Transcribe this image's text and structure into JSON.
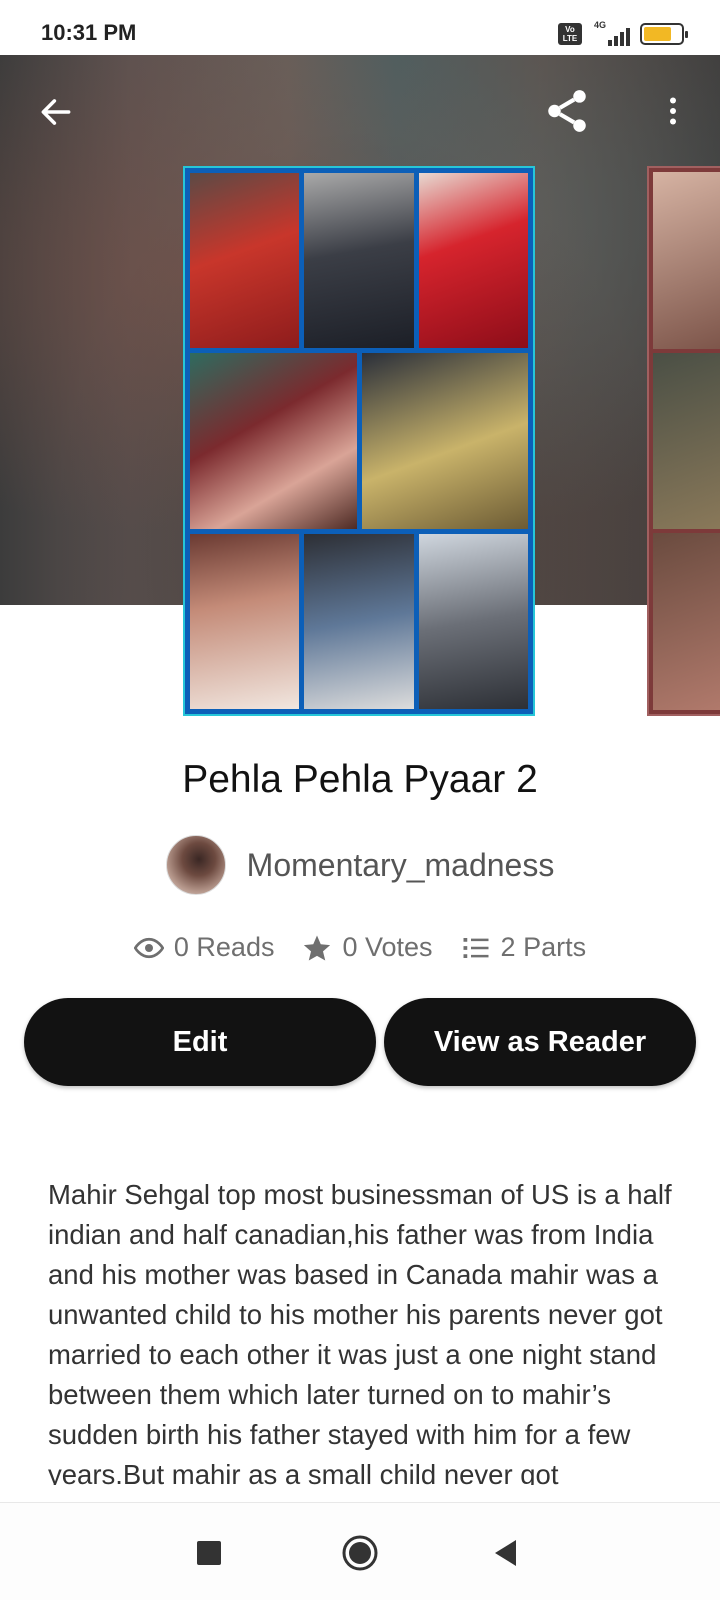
{
  "status_bar": {
    "time": "10:31 PM",
    "volte_label": "Vo LTE",
    "network_label": "4G",
    "battery_color": "#f2b824"
  },
  "toolbar": {
    "back_icon": "arrow-left-icon",
    "share_icon": "share-icon",
    "more_icon": "more-vertical-icon"
  },
  "story": {
    "title": "Pehla Pehla Pyaar 2",
    "author": "Momentary_madness",
    "stats": {
      "reads": "0 Reads",
      "votes": "0 Votes",
      "parts": "2 Parts"
    },
    "description": "Mahir Sehgal top most businessman of US is a half indian and half canadian,his father was from India and his mother was based in Canada mahir was a unwanted child to his mother his parents never got married to each other it was just a one night stand between them which later turned on to mahir’s sudden birth his father stayed with him for a few years.But mahir as a small child never got"
  },
  "actions": {
    "edit_label": "Edit",
    "view_label": "View as Reader"
  },
  "nav": {
    "recents_icon": "square-icon",
    "home_icon": "circle-icon",
    "back_icon": "triangle-back-icon"
  },
  "colors": {
    "button_bg": "#121212",
    "button_text": "#ffffff",
    "cover_frame": "#27c6d8"
  }
}
